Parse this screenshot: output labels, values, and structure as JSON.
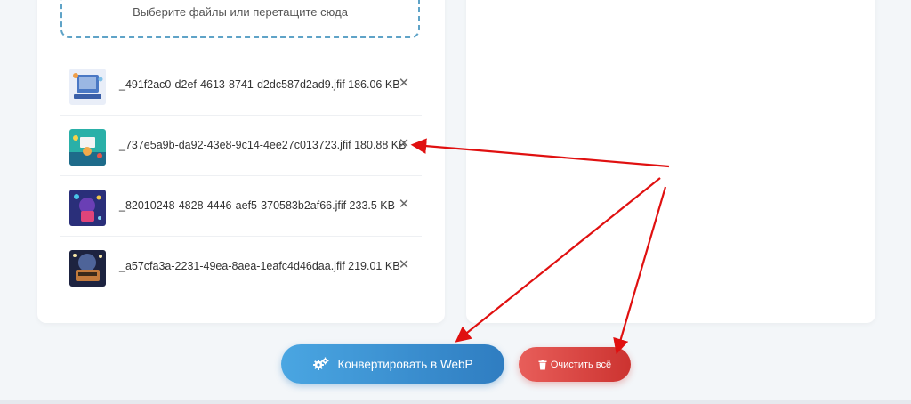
{
  "dropzone": {
    "text": "Выберите файлы или перетащите сюда"
  },
  "files": [
    {
      "name": "_491f2ac0-d2ef-4613-8741-d2dc587d2ad9.jfif",
      "size": "186.06 KB",
      "display": "_491f2ac0-d2ef-4613-8741-d2dc587d2ad9.jfif 186.06 KB",
      "thumb_colors": [
        "#e9eef8",
        "#4a78c4",
        "#9bb7e3"
      ]
    },
    {
      "name": "_737e5a9b-da92-43e8-9c14-4ee27c013723.jfif",
      "size": "180.88 KB",
      "display": "_737e5a9b-da92-43e8-9c14-4ee27c013723.jfif 180.88 KB",
      "thumb_colors": [
        "#2ab0a8",
        "#1e6b8a",
        "#f2a94a"
      ]
    },
    {
      "name": "_82010248-4828-4446-aef5-370583b2af66.jfif",
      "size": "233.5 KB",
      "display": "_82010248-4828-4446-aef5-370583b2af66.jfif 233.5 KB",
      "thumb_colors": [
        "#2a2f7a",
        "#6a3fb5",
        "#e0447a"
      ]
    },
    {
      "name": "_a57cfa3a-2231-49ea-8aea-1eafc4d46daa.jfif",
      "size": "219.01 KB",
      "display": "_a57cfa3a-2231-49ea-8aea-1eafc4d46daa.jfif 219.01 KB",
      "thumb_colors": [
        "#1d2340",
        "#c27a3c",
        "#6f8fd6"
      ]
    }
  ],
  "remove_glyph": "✕",
  "buttons": {
    "convert_label": "Конвертировать в WebP",
    "clear_label": "Очистить всё"
  },
  "icons": {
    "convert": "gears-icon",
    "clear": "trash-icon",
    "remove": "close-icon"
  },
  "colors": {
    "convert_start": "#4aa6e2",
    "convert_end": "#2f7dc1",
    "clear_start": "#e85e5a",
    "clear_end": "#cc3330",
    "dropzone_border": "#5fa3c7",
    "annotation_arrow": "#e01010"
  }
}
